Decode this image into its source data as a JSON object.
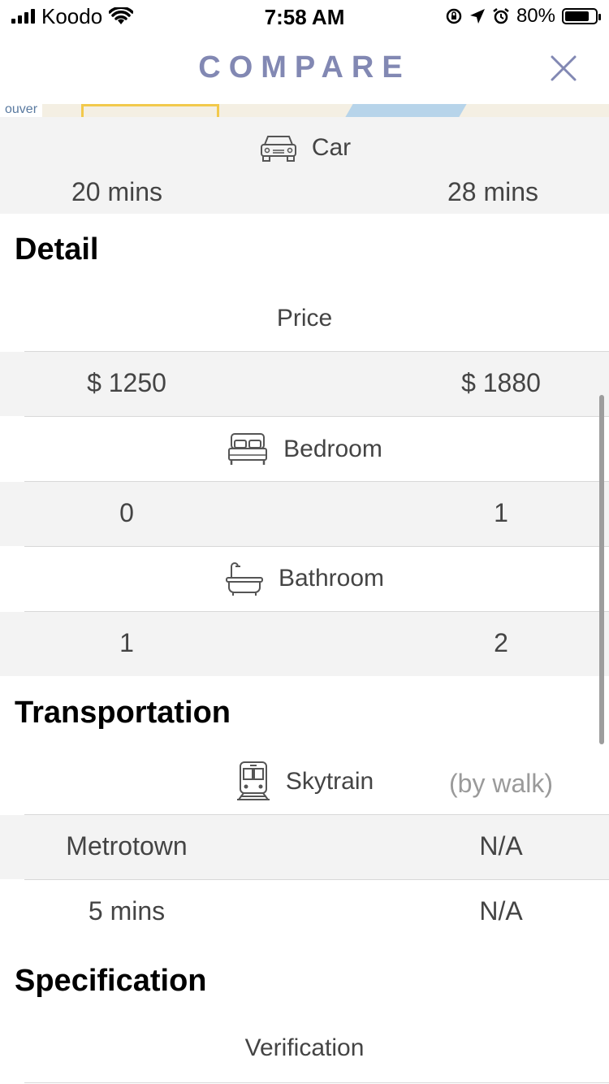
{
  "status_bar": {
    "carrier": "Koodo",
    "time": "7:58 AM",
    "battery": "80%",
    "battery_level": 0.8
  },
  "header": {
    "title": "COMPARE"
  },
  "map": {
    "label": "ouver"
  },
  "car": {
    "label": "Car",
    "left": "20 mins",
    "right": "28 mins"
  },
  "detail": {
    "title": "Detail",
    "price_label": "Price",
    "price_left": "$ 1250",
    "price_right": "$ 1880",
    "bedroom_label": "Bedroom",
    "bedroom_left": "0",
    "bedroom_right": "1",
    "bathroom_label": "Bathroom",
    "bathroom_left": "1",
    "bathroom_right": "2"
  },
  "transportation": {
    "title": "Transportation",
    "skytrain_label": "Skytrain",
    "skytrain_note": "(by walk)",
    "station_left": "Metrotown",
    "station_right": "N/A",
    "time_left": "5 mins",
    "time_right": "N/A"
  },
  "specification": {
    "title": "Specification",
    "verification_label": "Verification"
  },
  "icons": {
    "car": "car-icon",
    "bed": "bed-icon",
    "bath": "bathtub-icon",
    "train": "train-icon",
    "close": "close-icon"
  },
  "colors": {
    "accent": "#8288b3",
    "row_gray": "#f3f3f3"
  }
}
